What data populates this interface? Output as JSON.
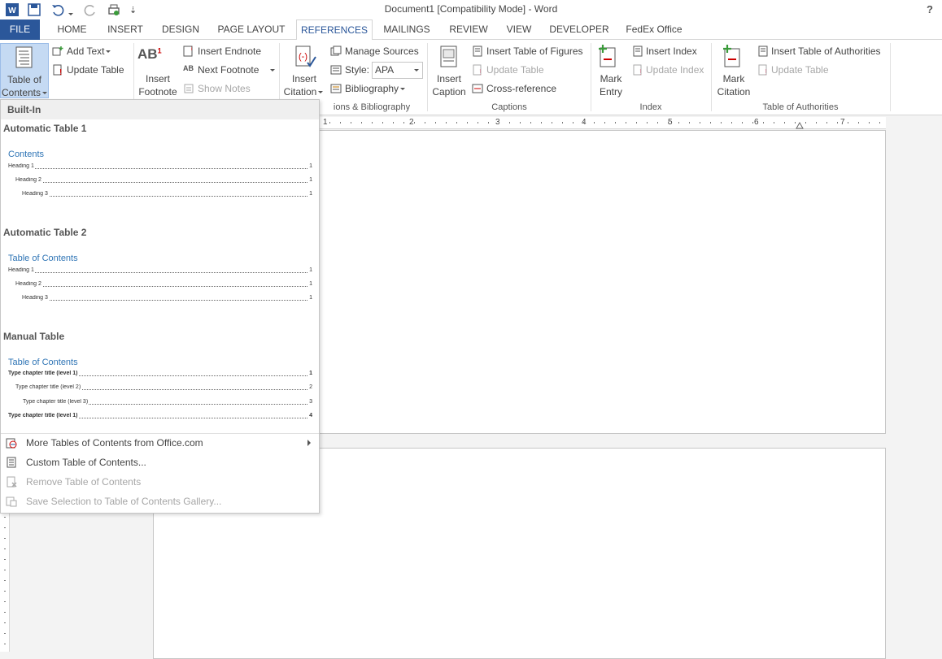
{
  "window": {
    "title": "Document1 [Compatibility Mode] - Word",
    "help": "?"
  },
  "tabs": [
    "FILE",
    "HOME",
    "INSERT",
    "DESIGN",
    "PAGE LAYOUT",
    "REFERENCES",
    "MAILINGS",
    "REVIEW",
    "VIEW",
    "DEVELOPER",
    "FedEx Office"
  ],
  "ribbon": {
    "toc": {
      "label1": "Table of",
      "label2": "Contents"
    },
    "add_text": "Add Text",
    "update_table": "Update Table",
    "insert_footnote": {
      "label1": "Insert",
      "label2": "Footnote"
    },
    "insert_endnote": "Insert Endnote",
    "next_footnote": "Next Footnote",
    "show_notes": "Show Notes",
    "insert_citation": {
      "label1": "Insert",
      "label2": "Citation"
    },
    "manage_sources": "Manage Sources",
    "style_label": "Style:",
    "style_value": "APA",
    "bibliography": "Bibliography",
    "citations_group": "ions & Bibliography",
    "insert_caption": {
      "label1": "Insert",
      "label2": "Caption"
    },
    "insert_table_of_figures": "Insert Table of Figures",
    "captions_update_table": "Update Table",
    "cross_reference": "Cross-reference",
    "captions_group": "Captions",
    "mark_entry": {
      "label1": "Mark",
      "label2": "Entry"
    },
    "insert_index": "Insert Index",
    "update_index": "Update Index",
    "index_group": "Index",
    "mark_citation": {
      "label1": "Mark",
      "label2": "Citation"
    },
    "insert_toa": "Insert Table of Authorities",
    "toa_update_table": "Update Table",
    "toa_group": "Table of Authorities"
  },
  "ruler": {
    "numbers": [
      "1",
      "2",
      "3",
      "4",
      "5",
      "6",
      "7"
    ]
  },
  "dropdown": {
    "section": "Built-In",
    "auto1": {
      "title": "Automatic Table 1",
      "heading": "Contents",
      "lines": [
        {
          "text": "Heading 1",
          "page": "1"
        },
        {
          "text": "Heading 2",
          "page": "1"
        },
        {
          "text": "Heading 3",
          "page": "1"
        }
      ]
    },
    "auto2": {
      "title": "Automatic Table 2",
      "heading": "Table of Contents",
      "lines": [
        {
          "text": "Heading 1",
          "page": "1"
        },
        {
          "text": "Heading 2",
          "page": "1"
        },
        {
          "text": "Heading 3",
          "page": "1"
        }
      ]
    },
    "manual": {
      "title": "Manual Table",
      "heading": "Table of Contents",
      "lines": [
        {
          "text": "Type chapter title (level 1)",
          "page": "1"
        },
        {
          "text": "Type chapter title (level 2)",
          "page": "2"
        },
        {
          "text": "Type chapter title (level 3)",
          "page": "3"
        },
        {
          "text": "Type chapter title (level 1)",
          "page": "4"
        }
      ]
    },
    "menu": {
      "more": "More Tables of Contents from Office.com",
      "custom": "Custom Table of Contents...",
      "remove": "Remove Table of Contents",
      "save": "Save Selection to Table of Contents Gallery..."
    }
  },
  "colors": {
    "file_tab": "#2b579a",
    "accent": "#2b579a",
    "toc_heading": "#2e74b5"
  }
}
